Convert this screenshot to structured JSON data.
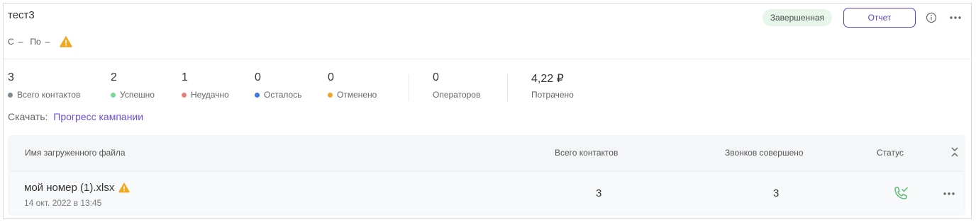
{
  "campaign": {
    "title": "тест3",
    "from_label": "С",
    "from_value": "–",
    "to_label": "По",
    "to_value": "–",
    "status_badge": "Завершенная",
    "report_button": "Отчет",
    "icons": {
      "warning": "warning-icon",
      "info": "info-icon",
      "more": "more-icon"
    }
  },
  "stats": [
    {
      "value": "3",
      "label": "Всего контактов",
      "dot_color": "#7f8a92"
    },
    {
      "value": "2",
      "label": "Успешно",
      "dot_color": "#7fd49a"
    },
    {
      "value": "1",
      "label": "Неудачно",
      "dot_color": "#e77e7a"
    },
    {
      "value": "0",
      "label": "Осталось",
      "dot_color": "#3a79e3"
    },
    {
      "value": "0",
      "label": "Отменено",
      "dot_color": "#f3a62a"
    }
  ],
  "operators": {
    "value": "0",
    "label": "Операторов"
  },
  "spent": {
    "value": "4,22 ₽",
    "label": "Потрачено"
  },
  "download": {
    "label": "Скачать:",
    "link": "Прогресс кампании"
  },
  "table": {
    "headers": {
      "file_name": "Имя загруженного файла",
      "total_contacts": "Всего контактов",
      "calls_made": "Звонков совершено",
      "status": "Статус"
    },
    "rows": [
      {
        "file_name": "мой номер (1).xlsx",
        "uploaded": "14 окт. 2022 в 13:45",
        "total_contacts": "3",
        "calls_made": "3",
        "status_icon": "phone-check-icon"
      }
    ]
  },
  "colors": {
    "accent": "#5b3fd1",
    "badge_bg": "#e7f6ea",
    "warning": "#f0a91c",
    "success": "#5cbf74"
  }
}
